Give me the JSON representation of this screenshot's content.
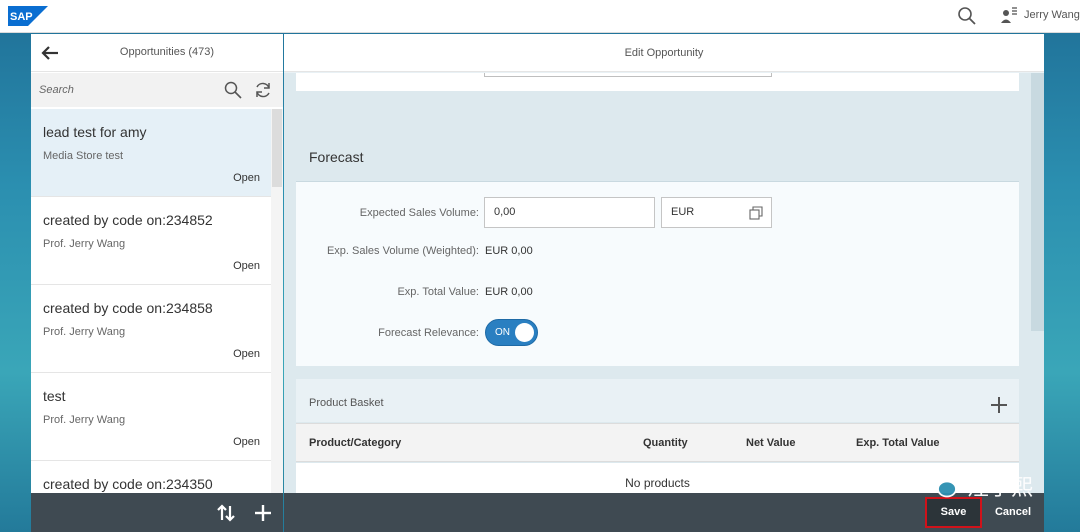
{
  "shell": {
    "logo_text": "SAP",
    "user_name": "Jerry Wang",
    "colors": {
      "brand_blue": "#0a6ed1",
      "background_teal": "#2b8fb0"
    }
  },
  "master": {
    "title": "Opportunities (473)",
    "search": {
      "placeholder": "Search",
      "value": ""
    },
    "items": [
      {
        "title": "lead test for amy",
        "subtitle": "Media Store test",
        "status": "Open",
        "selected": true
      },
      {
        "title": "created by code on:234852",
        "subtitle": "Prof. Jerry Wang",
        "status": "Open",
        "selected": false
      },
      {
        "title": "created by code on:234858",
        "subtitle": "Prof. Jerry Wang",
        "status": "Open",
        "selected": false
      },
      {
        "title": "test",
        "subtitle": "Prof. Jerry Wang",
        "status": "Open",
        "selected": false
      },
      {
        "title": "created by code on:234350",
        "subtitle": "",
        "status": "",
        "selected": false
      }
    ],
    "footer_icons": [
      "sort-icon",
      "add-icon"
    ]
  },
  "detail": {
    "title": "Edit Opportunity",
    "forecast": {
      "section_title": "Forecast",
      "expected_sales_volume_label": "Expected Sales Volume:",
      "expected_sales_volume_value": "0,00",
      "currency_value": "EUR",
      "weighted_label": "Exp. Sales Volume (Weighted):",
      "weighted_value": "EUR 0,00",
      "total_value_label": "Exp. Total Value:",
      "total_value_value": "EUR 0,00",
      "relevance_label": "Forecast Relevance:",
      "relevance_toggle": "ON"
    },
    "product_basket": {
      "section_title": "Product Basket",
      "columns": [
        "Product/Category",
        "Quantity",
        "Net Value",
        "Exp. Total Value"
      ],
      "empty_text": "No products"
    },
    "footer": {
      "save_label": "Save",
      "cancel_label": "Cancel"
    }
  },
  "watermark": {
    "text": "汪子熙",
    "icon": "wechat-icon"
  }
}
